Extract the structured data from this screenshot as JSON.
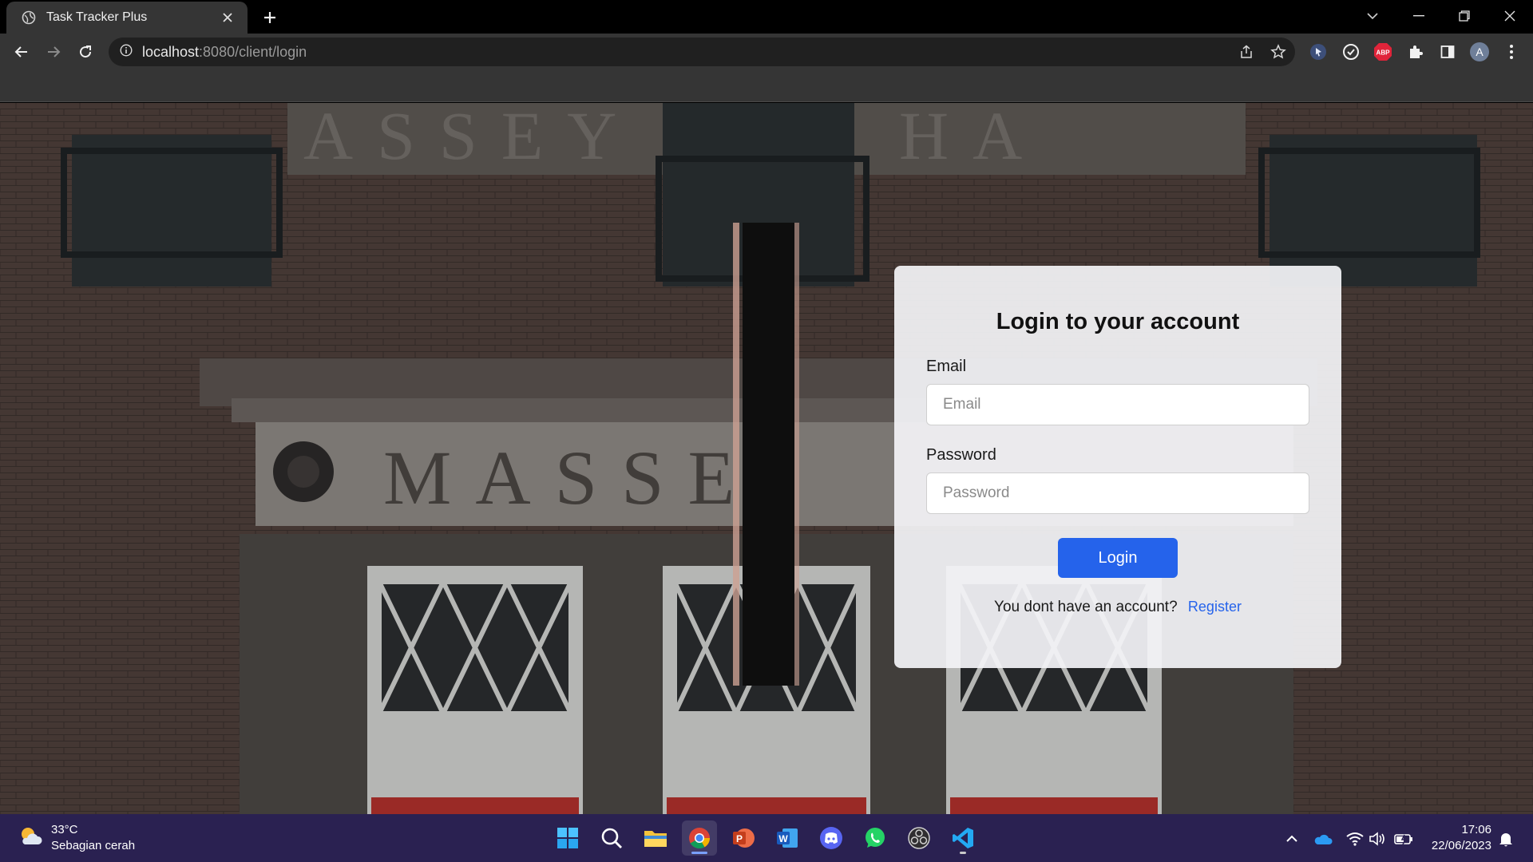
{
  "browser": {
    "tab_title": "Task Tracker Plus",
    "url_host": "localhost",
    "url_rest": ":8080/client/login",
    "extensions": [
      "cursor-extension-icon",
      "grammar-extension-icon",
      "adblock-plus-icon",
      "puzzle-icon",
      "side-panel-icon",
      "profile-avatar"
    ],
    "profile_initial": "A",
    "abp_label": "ABP"
  },
  "login": {
    "title": "Login to your account",
    "email_label": "Email",
    "email_placeholder": "Email",
    "password_label": "Password",
    "password_placeholder": "Password",
    "login_button": "Login",
    "register_prompt": "You dont have an account?",
    "register_link": "Register"
  },
  "background": {
    "sign_text": "MASSEY HALL",
    "visible_sign_text": "MASSE"
  },
  "taskbar": {
    "weather_temp": "33°C",
    "weather_desc": "Sebagian cerah",
    "time": "17:06",
    "date": "22/06/2023",
    "apps": [
      "windows-start-icon",
      "search-icon",
      "file-explorer-icon",
      "chrome-icon",
      "powerpoint-icon",
      "word-icon",
      "discord-icon",
      "whatsapp-icon",
      "obs-icon",
      "vscode-icon"
    ]
  },
  "colors": {
    "accent": "#2563eb",
    "taskbar": "#2a2151",
    "chrome_dark": "#353535"
  }
}
